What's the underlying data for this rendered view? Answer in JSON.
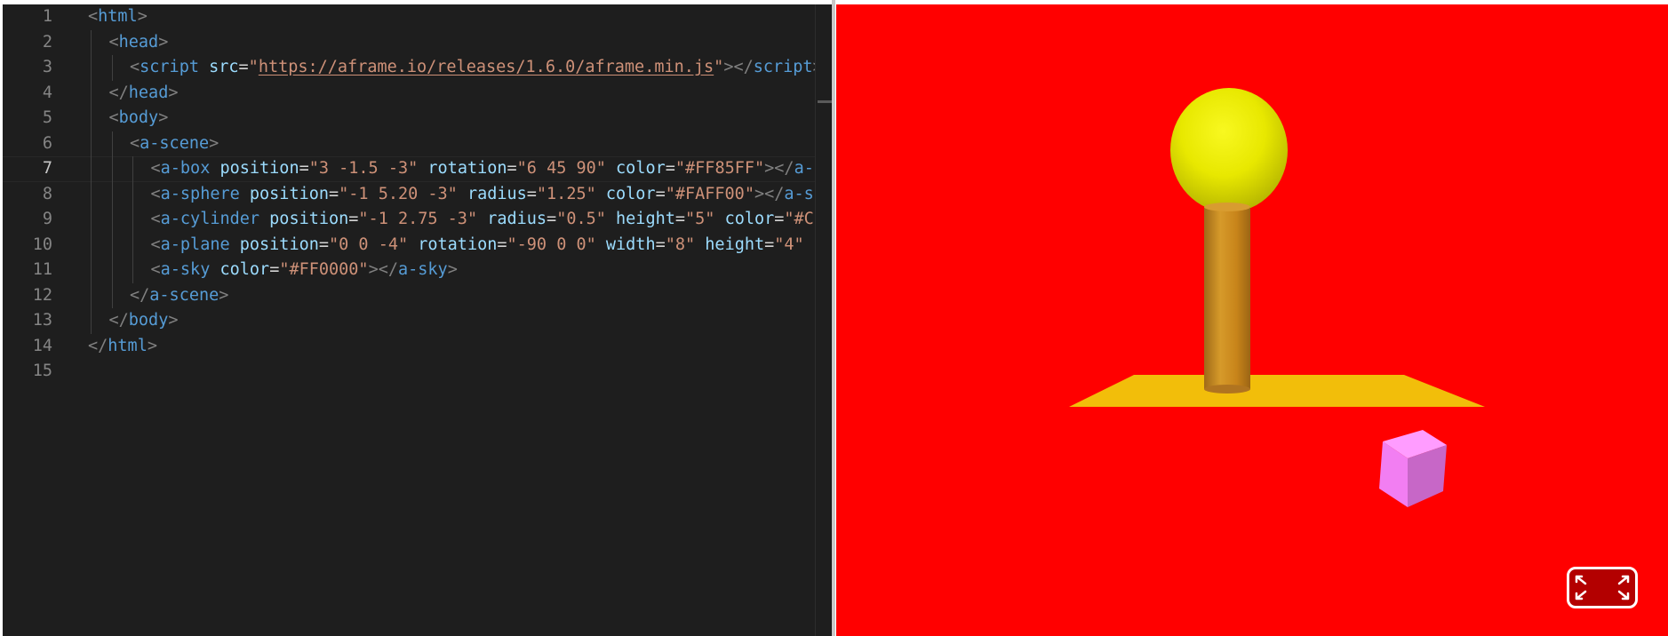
{
  "editor": {
    "current_line": 7,
    "lines": [
      {
        "number": "1",
        "tokens": [
          {
            "t": "<",
            "c": "punct"
          },
          {
            "t": "html",
            "c": "tag"
          },
          {
            "t": ">",
            "c": "punct"
          }
        ],
        "indent": 0
      },
      {
        "number": "2",
        "tokens": [
          {
            "t": "<",
            "c": "punct"
          },
          {
            "t": "head",
            "c": "tag"
          },
          {
            "t": ">",
            "c": "punct"
          }
        ],
        "indent": 1
      },
      {
        "number": "3",
        "tokens": [
          {
            "t": "<",
            "c": "punct"
          },
          {
            "t": "script",
            "c": "tag"
          },
          {
            "t": " ",
            "c": "space"
          },
          {
            "t": "src",
            "c": "attr"
          },
          {
            "t": "=",
            "c": "eq"
          },
          {
            "t": "\"",
            "c": "str"
          },
          {
            "t": "https://aframe.io/releases/1.6.0/aframe.min.js",
            "c": "link"
          },
          {
            "t": "\"",
            "c": "str"
          },
          {
            "t": "></",
            "c": "punct"
          },
          {
            "t": "script",
            "c": "tag"
          },
          {
            "t": ">",
            "c": "punct"
          }
        ],
        "indent": 2
      },
      {
        "number": "4",
        "tokens": [
          {
            "t": "</",
            "c": "punct"
          },
          {
            "t": "head",
            "c": "tag"
          },
          {
            "t": ">",
            "c": "punct"
          }
        ],
        "indent": 1
      },
      {
        "number": "5",
        "tokens": [
          {
            "t": "<",
            "c": "punct"
          },
          {
            "t": "body",
            "c": "tag"
          },
          {
            "t": ">",
            "c": "punct"
          }
        ],
        "indent": 1
      },
      {
        "number": "6",
        "tokens": [
          {
            "t": "<",
            "c": "punct"
          },
          {
            "t": "a-scene",
            "c": "tag"
          },
          {
            "t": ">",
            "c": "punct"
          }
        ],
        "indent": 2
      },
      {
        "number": "7",
        "tokens": [
          {
            "t": "<",
            "c": "punct"
          },
          {
            "t": "a-box",
            "c": "tag"
          },
          {
            "t": " ",
            "c": "space"
          },
          {
            "t": "position",
            "c": "attr"
          },
          {
            "t": "=",
            "c": "eq"
          },
          {
            "t": "\"3 -1.5 -3\"",
            "c": "str"
          },
          {
            "t": " ",
            "c": "space"
          },
          {
            "t": "rotation",
            "c": "attr"
          },
          {
            "t": "=",
            "c": "eq"
          },
          {
            "t": "\"6 45 90\"",
            "c": "str"
          },
          {
            "t": " ",
            "c": "space"
          },
          {
            "t": "color",
            "c": "attr"
          },
          {
            "t": "=",
            "c": "eq"
          },
          {
            "t": "\"#FF85FF\"",
            "c": "str"
          },
          {
            "t": "></",
            "c": "punct"
          },
          {
            "t": "a-box",
            "c": "tag"
          },
          {
            "t": ">",
            "c": "punct"
          }
        ],
        "indent": 3
      },
      {
        "number": "8",
        "tokens": [
          {
            "t": "<",
            "c": "punct"
          },
          {
            "t": "a-sphere",
            "c": "tag"
          },
          {
            "t": " ",
            "c": "space"
          },
          {
            "t": "position",
            "c": "attr"
          },
          {
            "t": "=",
            "c": "eq"
          },
          {
            "t": "\"-1 5.20 -3\"",
            "c": "str"
          },
          {
            "t": " ",
            "c": "space"
          },
          {
            "t": "radius",
            "c": "attr"
          },
          {
            "t": "=",
            "c": "eq"
          },
          {
            "t": "\"1.25\"",
            "c": "str"
          },
          {
            "t": " ",
            "c": "space"
          },
          {
            "t": "color",
            "c": "attr"
          },
          {
            "t": "=",
            "c": "eq"
          },
          {
            "t": "\"#FAFF00\"",
            "c": "str"
          },
          {
            "t": "></",
            "c": "punct"
          },
          {
            "t": "a-sphere",
            "c": "tag"
          },
          {
            "t": ">",
            "c": "punct"
          }
        ],
        "indent": 3
      },
      {
        "number": "9",
        "tokens": [
          {
            "t": "<",
            "c": "punct"
          },
          {
            "t": "a-cylinder",
            "c": "tag"
          },
          {
            "t": " ",
            "c": "space"
          },
          {
            "t": "position",
            "c": "attr"
          },
          {
            "t": "=",
            "c": "eq"
          },
          {
            "t": "\"-1 2.75 -3\"",
            "c": "str"
          },
          {
            "t": " ",
            "c": "space"
          },
          {
            "t": "radius",
            "c": "attr"
          },
          {
            "t": "=",
            "c": "eq"
          },
          {
            "t": "\"0.5\"",
            "c": "str"
          },
          {
            "t": " ",
            "c": "space"
          },
          {
            "t": "height",
            "c": "attr"
          },
          {
            "t": "=",
            "c": "eq"
          },
          {
            "t": "\"5\"",
            "c": "str"
          },
          {
            "t": " ",
            "c": "space"
          },
          {
            "t": "color",
            "c": "attr"
          },
          {
            "t": "=",
            "c": "eq"
          },
          {
            "t": "\"#C",
            "c": "str"
          }
        ],
        "indent": 3
      },
      {
        "number": "10",
        "tokens": [
          {
            "t": "<",
            "c": "punct"
          },
          {
            "t": "a-plane",
            "c": "tag"
          },
          {
            "t": " ",
            "c": "space"
          },
          {
            "t": "position",
            "c": "attr"
          },
          {
            "t": "=",
            "c": "eq"
          },
          {
            "t": "\"0 0 -4\"",
            "c": "str"
          },
          {
            "t": " ",
            "c": "space"
          },
          {
            "t": "rotation",
            "c": "attr"
          },
          {
            "t": "=",
            "c": "eq"
          },
          {
            "t": "\"-90 0 0\"",
            "c": "str"
          },
          {
            "t": " ",
            "c": "space"
          },
          {
            "t": "width",
            "c": "attr"
          },
          {
            "t": "=",
            "c": "eq"
          },
          {
            "t": "\"8\"",
            "c": "str"
          },
          {
            "t": " ",
            "c": "space"
          },
          {
            "t": "height",
            "c": "attr"
          },
          {
            "t": "=",
            "c": "eq"
          },
          {
            "t": "\"4\"",
            "c": "str"
          }
        ],
        "indent": 3
      },
      {
        "number": "11",
        "tokens": [
          {
            "t": "<",
            "c": "punct"
          },
          {
            "t": "a-sky",
            "c": "tag"
          },
          {
            "t": " ",
            "c": "space"
          },
          {
            "t": "color",
            "c": "attr"
          },
          {
            "t": "=",
            "c": "eq"
          },
          {
            "t": "\"#FF0000\"",
            "c": "str"
          },
          {
            "t": "></",
            "c": "punct"
          },
          {
            "t": "a-sky",
            "c": "tag"
          },
          {
            "t": ">",
            "c": "punct"
          }
        ],
        "indent": 3
      },
      {
        "number": "12",
        "tokens": [
          {
            "t": "</",
            "c": "punct"
          },
          {
            "t": "a-scene",
            "c": "tag"
          },
          {
            "t": ">",
            "c": "punct"
          }
        ],
        "indent": 2
      },
      {
        "number": "13",
        "tokens": [
          {
            "t": "</",
            "c": "punct"
          },
          {
            "t": "body",
            "c": "tag"
          },
          {
            "t": ">",
            "c": "punct"
          }
        ],
        "indent": 1
      },
      {
        "number": "14",
        "tokens": [
          {
            "t": "</",
            "c": "punct"
          },
          {
            "t": "html",
            "c": "tag"
          },
          {
            "t": ">",
            "c": "punct"
          }
        ],
        "indent": 0
      },
      {
        "number": "15",
        "tokens": [],
        "indent": 0
      }
    ]
  },
  "preview": {
    "sky_color": "#FF0000",
    "box_color": "#FF85FF",
    "sphere_color": "#FAFF00",
    "cylinder_color": "#C8841A",
    "plane_color": "#F2BE0A",
    "fullscreen_icon": "fullscreen-icon"
  },
  "colors": {
    "editor_bg": "#1E1E1E",
    "line_number": "#858585",
    "tag": "#569CD6",
    "attribute": "#9CDCFE",
    "string": "#CE9178",
    "punctuation": "#808080"
  }
}
